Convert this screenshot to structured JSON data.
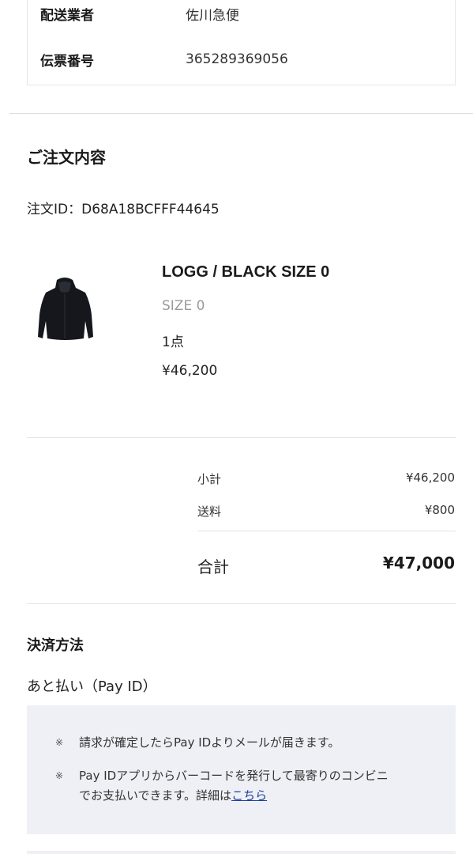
{
  "shipping": {
    "carrier_label": "配送業者",
    "carrier_value": "佐川急便",
    "tracking_label": "伝票番号",
    "tracking_value": "365289369056"
  },
  "order": {
    "section_title": "ご注文内容",
    "order_id": "注文ID：D68A18BCFFF44645",
    "item": {
      "name": "LOGG / BLACK SIZE 0",
      "size": "SIZE 0",
      "quantity": "1点",
      "price": "¥46,200",
      "image_icon": "black-hooded-jacket-image"
    }
  },
  "summary": {
    "subtotal_label": "小計",
    "subtotal_value": "¥46,200",
    "shipping_label": "送料",
    "shipping_value": "¥800",
    "total_label": "合計",
    "total_value": "¥47,000"
  },
  "payment": {
    "title": "決済方法",
    "method": "あと払い（Pay ID）",
    "note_mark": "※",
    "note1": "請求が確定したらPay IDよりメールが届きます。",
    "note2_line1": "Pay IDアプリからバーコードを発行して最寄りのコンビニ",
    "note2_line2": "でお支払いできます。詳細は",
    "note2_link": "こちら"
  },
  "colors": {
    "link": "#1f3d9c",
    "note_bg": "#eef0f5",
    "muted": "#9a9a9a"
  }
}
